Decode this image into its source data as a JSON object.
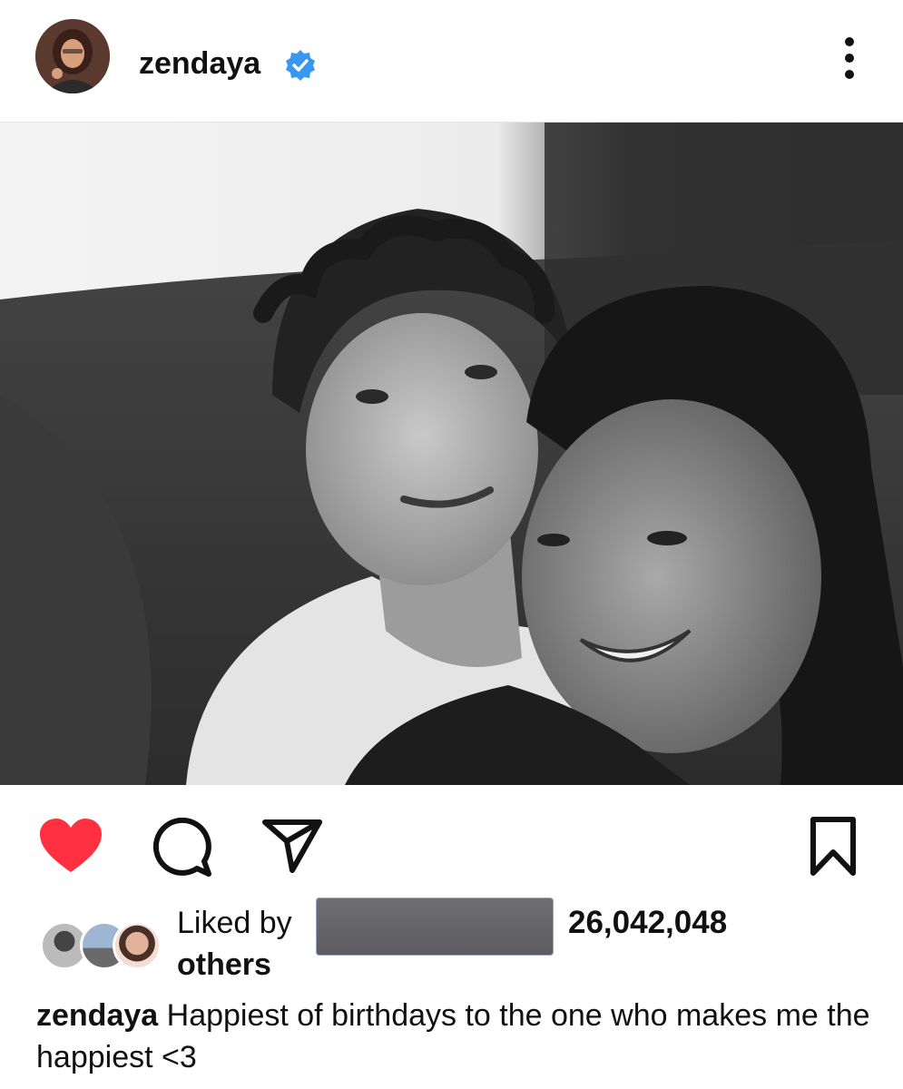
{
  "header": {
    "username": "zendaya",
    "verified": true,
    "avatar_icon": "profile-avatar",
    "more_icon": "more-vertical-icon",
    "verified_color": "#3897f0"
  },
  "post": {
    "image_icon": "photo-black-and-white-couple"
  },
  "actions": {
    "liked": true,
    "like_color": "#ff3040",
    "like_icon": "heart-icon",
    "comment_icon": "comment-icon",
    "share_icon": "share-icon",
    "save_icon": "bookmark-icon"
  },
  "likes": {
    "liked_by_label": "Liked by",
    "others_label": "others",
    "count": "26,042,048"
  },
  "caption": {
    "username": "zendaya",
    "text": " Happiest of birthdays to the one who makes me the happiest <3"
  }
}
